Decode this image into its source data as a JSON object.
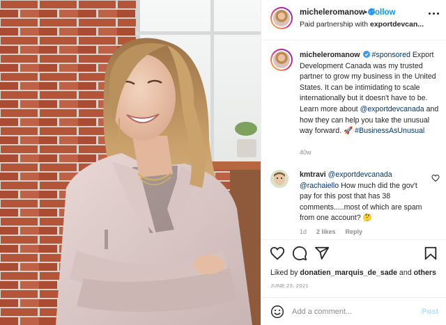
{
  "header": {
    "username": "micheleromanow",
    "follow_label": "Follow",
    "separator": "•",
    "partnership_prefix": "Paid partnership with",
    "partner": "exportdevcan..."
  },
  "caption": {
    "username": "micheleromanow",
    "hashtag_sponsored": "#sponsored",
    "text_1": "Export Development Canada was my trusted partner to grow my business in the United States. It can be intimidating to scale internationally but it doesn't have to be. Learn more about",
    "mention": "@exportdevcanada",
    "text_2": "and how they can help you take the unusual way forward.",
    "emoji": "🚀",
    "hashtag_business": "#BusinessAsUnusual",
    "time": "40w"
  },
  "comment": {
    "username": "kmtravi",
    "mention_1": "@exportdevcanada",
    "mention_2": "@rachaiello",
    "text": "How much did the gov't pay for this post that has 38 comments.....most of which are spam from one account?",
    "emoji": "🤔",
    "time": "1d",
    "likes": "2 likes",
    "reply_label": "Reply"
  },
  "actions": {
    "icons": [
      "heart-icon",
      "comment-icon",
      "share-icon",
      "bookmark-icon"
    ]
  },
  "likes": {
    "prefix": "Liked by",
    "user": "donatien_marquis_de_sade",
    "conjunction": "and",
    "others": "others"
  },
  "date": "JUNE 23, 2021",
  "add_comment": {
    "placeholder": "Add a comment...",
    "post_label": "Post"
  },
  "colors": {
    "link_blue": "#0095f6",
    "mention_blue": "#00376b",
    "verified_blue": "#3897f0",
    "muted": "#8e8e8e",
    "post_disabled": "#b2dffc"
  }
}
